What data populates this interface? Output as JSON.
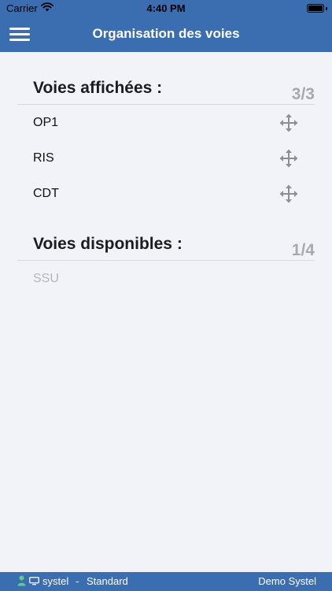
{
  "status_bar": {
    "carrier": "Carrier",
    "time": "4:40 PM"
  },
  "header": {
    "title": "Organisation des voies"
  },
  "displayed": {
    "title": "Voies affichées :",
    "count": "3/3",
    "items": [
      {
        "label": "OP1"
      },
      {
        "label": "RIS"
      },
      {
        "label": "CDT"
      }
    ]
  },
  "available": {
    "title": "Voies disponibles :",
    "count": "1/4",
    "items": [
      {
        "label": "SSU"
      }
    ]
  },
  "footer": {
    "user": "systel",
    "separator": "-",
    "profile": "Standard",
    "site": "Demo Systel",
    "accent": "#3b6db1",
    "user_icon_color": "#5ecf7b"
  },
  "icons": {
    "menu": "hamburger-icon",
    "drag": "move-arrows-icon",
    "user": "person-icon",
    "screen": "monitor-icon"
  }
}
